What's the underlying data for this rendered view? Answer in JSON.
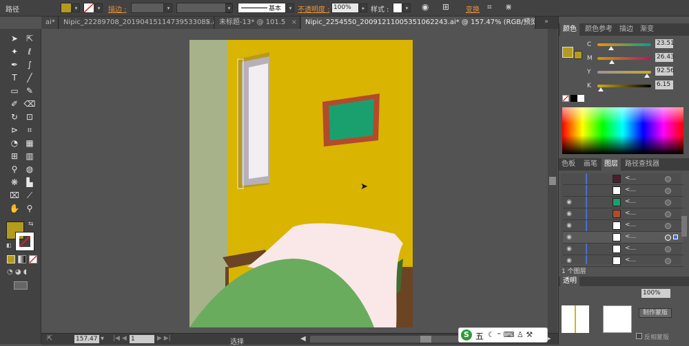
{
  "control_bar": {
    "selection_label": "路径",
    "stroke_label": "描边 :",
    "brush_value": "基本",
    "opacity_label": "不透明度 :",
    "opacity_value": "100%",
    "style_label": "样式 :",
    "transform_label": "变换"
  },
  "tabs": [
    {
      "label": "Nipic_22289708_20190415114739533085.ai*",
      "active": false
    },
    {
      "label": "未标题-13* @ 101.5",
      "active": false
    },
    {
      "label": "Nipic_2254550_20091211005351062243.ai* @ 157.47% (RGB/预览)",
      "active": true
    }
  ],
  "tab_prefix": "ai*",
  "panels": {
    "color_tabs": [
      "颜色",
      "颜色参考",
      "描边",
      "渐变"
    ],
    "cmyk": [
      {
        "channel": "C",
        "value": "23.51"
      },
      {
        "channel": "M",
        "value": "26.43"
      },
      {
        "channel": "Y",
        "value": "92.56"
      },
      {
        "channel": "K",
        "value": "6.15"
      }
    ],
    "layer_tabs": [
      "色板",
      "画笔",
      "图层",
      "路径查找器"
    ],
    "layers": [
      {
        "name": "<...",
        "swatch": "#4a1e2a",
        "visible": false
      },
      {
        "name": "<...",
        "swatch": "#ffffff",
        "visible": false
      },
      {
        "name": "<...",
        "swatch": "#1aa06e",
        "visible": true
      },
      {
        "name": "<...",
        "swatch": "#b34a2c",
        "visible": true
      },
      {
        "name": "<...",
        "swatch": "#ffffff",
        "visible": true
      },
      {
        "name": "<...",
        "swatch": "#ffffff",
        "visible": true
      },
      {
        "name": "<...",
        "swatch": "#ffffff",
        "visible": true
      },
      {
        "name": "<...",
        "swatch": "#ffffff",
        "visible": true
      }
    ],
    "layer_count": "1 个图层",
    "transparency_label": "透明",
    "transparency_value": "100%",
    "mask_label": "制作蒙版",
    "invert_mask_label": "反相蒙版"
  },
  "status": {
    "zoom": "157.47",
    "page": "1",
    "mode": "选择"
  },
  "colors": {
    "fill": "#b59b1c",
    "wall": "#d9b400",
    "side_wall": "#a8b28a",
    "frame": "#b34a2c",
    "picture": "#1aa06e",
    "pillow": "#fae8e8",
    "blanket": "#6aac5e",
    "wood": "#6b4424"
  }
}
